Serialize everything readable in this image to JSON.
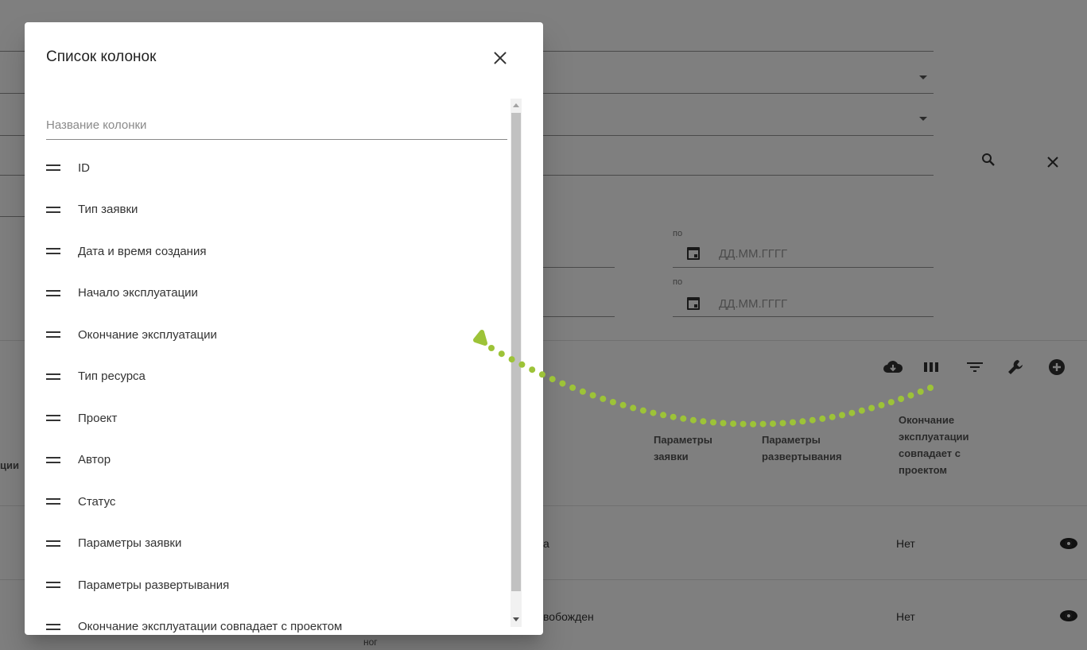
{
  "dialog": {
    "title": "Список колонок",
    "search_placeholder": "Название колонки",
    "columns": [
      "ID",
      "Тип заявки",
      "Дата и время создания",
      "Начало эксплуатации",
      "Окончание эксплуатации",
      "Тип ресурса",
      "Проект",
      "Автор",
      "Статус",
      "Параметры заявки",
      "Параметры развертывания",
      "Окончание эксплуатации совпадает с проектом"
    ]
  },
  "background": {
    "filters": {
      "date_to_label_1": "по",
      "date_to_label_2": "по",
      "date_placeholder": "ДД.ММ.ГГГГ"
    },
    "table": {
      "partial_header": "ции",
      "headers": {
        "request_params": "Параметры заявки",
        "deploy_params": "Параметры развертывания",
        "end_matches_project": "Окончание эксплуатации совпадает с проектом"
      },
      "rows": [
        {
          "partial_cell": "а",
          "end_matches_project": "Нет"
        },
        {
          "partial_cell": "вобожден",
          "end_matches_project": "Нет",
          "partial_below": "ног"
        }
      ]
    }
  },
  "annotation": {
    "color": "#9dc338"
  },
  "icons": {
    "close": "close-icon",
    "drag": "drag-handle-icon",
    "search": "search-icon",
    "clear": "close-icon",
    "calendar": "calendar-icon",
    "download": "cloud-download-icon",
    "columns": "view-columns-icon",
    "filter": "filter-icon",
    "settings": "wrench-icon",
    "add": "add-circle-icon",
    "view": "eye-icon"
  }
}
